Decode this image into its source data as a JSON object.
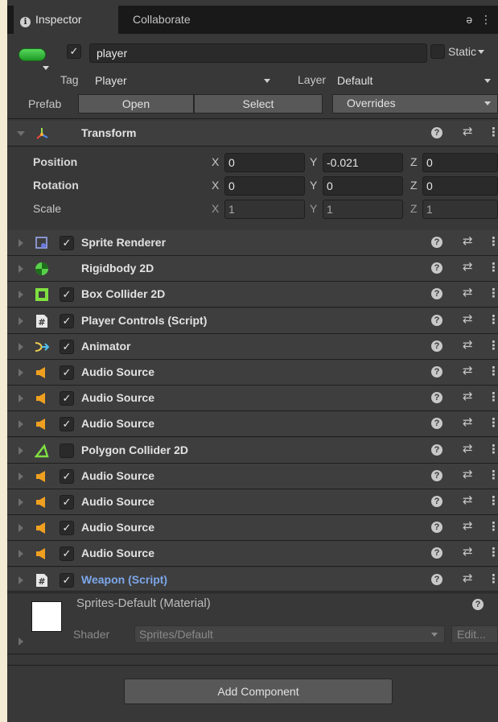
{
  "tabs": {
    "inspector": "Inspector",
    "collaborate": "Collaborate",
    "lock_icon": "ә",
    "menu_icon": "⋮"
  },
  "header": {
    "active_checked": true,
    "name": "player",
    "static_label": "Static",
    "tag_label": "Tag",
    "tag_value": "Player",
    "layer_label": "Layer",
    "layer_value": "Default",
    "prefab_label": "Prefab",
    "open_label": "Open",
    "select_label": "Select",
    "overrides_label": "Overrides"
  },
  "transform": {
    "name": "Transform",
    "rows": [
      {
        "label": "Position",
        "x": "0",
        "y": "-0.021",
        "z": "0"
      },
      {
        "label": "Rotation",
        "x": "0",
        "y": "0",
        "z": "0"
      },
      {
        "label": "Scale",
        "x": "1",
        "y": "1",
        "z": "1"
      }
    ],
    "axis_x": "X",
    "axis_y": "Y",
    "axis_z": "Z"
  },
  "components": [
    {
      "name": "Sprite Renderer",
      "icon": "sprite-renderer-icon",
      "checkbox": true
    },
    {
      "name": "Rigidbody 2D",
      "icon": "rigidbody-icon",
      "checkbox": null
    },
    {
      "name": "Box Collider 2D",
      "icon": "box-collider-icon",
      "checkbox": true
    },
    {
      "name": "Player Controls (Script)",
      "icon": "script-icon",
      "checkbox": true
    },
    {
      "name": "Animator",
      "icon": "animator-icon",
      "checkbox": true
    },
    {
      "name": "Audio Source",
      "icon": "audio-source-icon",
      "checkbox": true
    },
    {
      "name": "Audio Source",
      "icon": "audio-source-icon",
      "checkbox": true
    },
    {
      "name": "Audio Source",
      "icon": "audio-source-icon",
      "checkbox": true
    },
    {
      "name": "Polygon Collider 2D",
      "icon": "polygon-collider-icon",
      "checkbox": false
    },
    {
      "name": "Audio Source",
      "icon": "audio-source-icon",
      "checkbox": true
    },
    {
      "name": "Audio Source",
      "icon": "audio-source-icon",
      "checkbox": true
    },
    {
      "name": "Audio Source",
      "icon": "audio-source-icon",
      "checkbox": true
    },
    {
      "name": "Audio Source",
      "icon": "audio-source-icon",
      "checkbox": true
    },
    {
      "name": "Weapon (Script)",
      "icon": "script-icon",
      "checkbox": true,
      "highlight": true
    }
  ],
  "material": {
    "name": "Sprites-Default (Material)",
    "shader_label": "Shader",
    "shader_value": "Sprites/Default",
    "edit_label": "Edit..."
  },
  "add_component_label": "Add Component",
  "colors": {
    "panel": "#383838",
    "header": "#3e3e3e",
    "field": "#2a2a2a",
    "script_name_highlight": "#7ca7ea",
    "audio_icon": "#f0a020"
  }
}
